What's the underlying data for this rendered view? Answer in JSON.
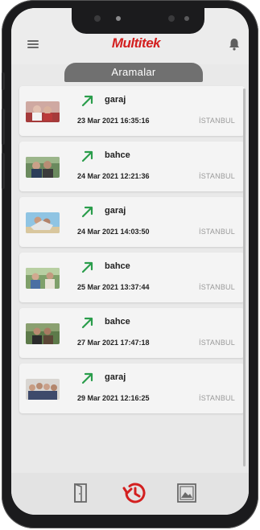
{
  "app": {
    "logo_text": "Multitek",
    "title": "Aramalar",
    "brand_color": "#d32020",
    "arrow_color": "#2a9d4b"
  },
  "icons": {
    "menu": "menu-icon",
    "bell": "bell-icon",
    "door": "door-icon",
    "history": "history-icon",
    "gallery": "gallery-icon",
    "call": "outgoing-call-arrow-icon"
  },
  "calls": [
    {
      "name": "garaj",
      "datetime": "23 Mar 2021 16:35:16",
      "city": "İSTANBUL"
    },
    {
      "name": "bahce",
      "datetime": "24 Mar 2021 12:21:36",
      "city": "İSTANBUL"
    },
    {
      "name": "garaj",
      "datetime": "24 Mar 2021 14:03:50",
      "city": "İSTANBUL"
    },
    {
      "name": "bahce",
      "datetime": "25 Mar 2021 13:37:44",
      "city": "İSTANBUL"
    },
    {
      "name": "bahce",
      "datetime": "27 Mar 2021 17:47:18",
      "city": "İSTANBUL"
    },
    {
      "name": "garaj",
      "datetime": "29 Mar 2021 12:16:25",
      "city": "İSTANBUL"
    }
  ]
}
